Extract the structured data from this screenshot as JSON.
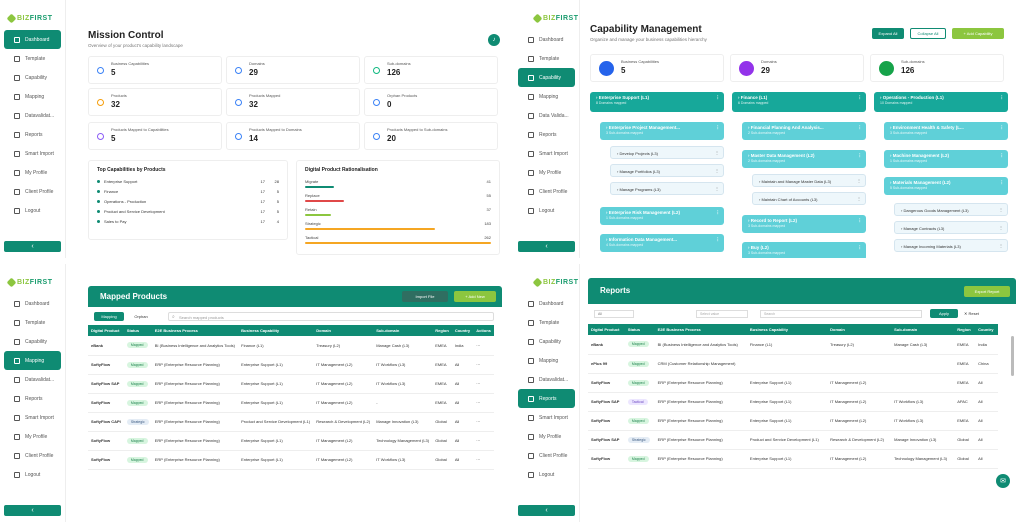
{
  "brand": {
    "name_a": "BIZ",
    "name_b": "FIRST"
  },
  "nav1": [
    "Dashboard",
    "Template",
    "Capability",
    "Mapping",
    "Datavalidat...",
    "Reports",
    "Smart Import",
    "My Profile",
    "Client Profile",
    "Logout"
  ],
  "nav2": [
    "Dashboard",
    "Template",
    "Capability",
    "Mapping",
    "Data Valida...",
    "Reports",
    "Smart Import",
    "My Profile",
    "Client Profile",
    "Logout"
  ],
  "nav3": [
    "Dashboard",
    "Template",
    "Capability",
    "Mapping",
    "Datavalidat...",
    "Reports",
    "Smart Import",
    "My Profile",
    "Client Profile",
    "Logout"
  ],
  "nav4": [
    "Dashboard",
    "Template",
    "Capability",
    "Mapping",
    "Datavalidat...",
    "Reports",
    "Smart Import",
    "My Profile",
    "Client Profile",
    "Logout"
  ],
  "collapse_glyph": "‹",
  "mission": {
    "title": "Mission Control",
    "subtitle": "Overview of your product's capability landscape",
    "stats": [
      {
        "label": "Business Capabilities",
        "value": "5"
      },
      {
        "label": "Domains",
        "value": "29"
      },
      {
        "label": "Sub-domains",
        "value": "126"
      },
      {
        "label": "Products",
        "value": "32"
      },
      {
        "label": "Products Mapped",
        "value": "32"
      },
      {
        "label": "Orphan Products",
        "value": "0"
      },
      {
        "label": "Products Mapped to Capabilities",
        "value": "5"
      },
      {
        "label": "Products Mapped to Domains",
        "value": "14"
      },
      {
        "label": "Products Mapped to Sub-domains",
        "value": "20"
      }
    ],
    "top_title": "Top Capabilities by Products",
    "top_items": [
      {
        "name": "Enterprise Support",
        "a": "17",
        "b": "28"
      },
      {
        "name": "Finance",
        "a": "17",
        "b": "5"
      },
      {
        "name": "Operations - Production",
        "a": "17",
        "b": "5"
      },
      {
        "name": "Product and Service Development",
        "a": "17",
        "b": "5"
      },
      {
        "name": "Sales to Pay",
        "a": "17",
        "b": "4"
      }
    ],
    "rat_title": "Digital Product Rationalisation",
    "rat_items": [
      {
        "name": "Migrate",
        "value": "41"
      },
      {
        "name": "Replace",
        "value": "55"
      },
      {
        "name": "Retain",
        "value": "37"
      },
      {
        "name": "Strategic",
        "value": "183"
      },
      {
        "name": "Tactical",
        "value": "262"
      }
    ]
  },
  "capability": {
    "title": "Capability Management",
    "subtitle": "Organize and manage your business capabilities hierarchy",
    "expand_all": "Expand All",
    "collapse_all": "Collapse All",
    "add": "+ Add Capability",
    "stats": [
      {
        "label": "Business Capabilities",
        "value": "5"
      },
      {
        "label": "Domains",
        "value": "29"
      },
      {
        "label": "Sub-domains",
        "value": "126"
      }
    ],
    "col1": {
      "title": "Enterprise Support (L1)",
      "sub": "8 Domains mapped",
      "domain": "Enterprise Project Management...",
      "domain_sub": "3 Sub-domains mapped",
      "leaves": [
        "Develop Projects (L3)",
        "Manage Portfolios (L3)",
        "Manage Programs (L3)"
      ],
      "d2": "Enterprise Risk Management (L2)",
      "d2_sub": "1 Sub-domains mapped",
      "d3": "Information Data Management...",
      "d3_sub": "4 Sub-domains mapped"
    },
    "col2": {
      "title": "Finance (L1)",
      "sub": "6 Domains mapped",
      "domain": "Financial Planning And Analysis...",
      "domain_sub": "2 Sub-domains mapped",
      "d2": "Master Data Management (L2)",
      "d2_sub": "2 Sub-domains mapped",
      "leaves": [
        "Maintain and Manage Master Data (L3)",
        "Maintain Chart of Accounts (L3)"
      ],
      "d3": "Record to Report (L2)",
      "d3_sub": "3 Sub-domains mapped",
      "d4": "Buy (L2)",
      "d4_sub": "3 Sub-domains mapped"
    },
    "col3": {
      "title": "Operations - Production (L1)",
      "sub": "10 Domains mapped",
      "domain": "Environment Health & Safety (L...",
      "domain_sub": "3 Sub-domains mapped",
      "d2": "Machine Management (L2)",
      "d2_sub": "1 Sub-domains mapped",
      "d3": "Materials Management (L2)",
      "d3_sub": "5 Sub-domains mapped",
      "leaves": [
        "Dangerous Goods Management (L3)",
        "Manage Contracts (L3)",
        "Manage Incoming Materials (L3)"
      ]
    }
  },
  "mapped": {
    "title": "Mapped Products",
    "import": "Import File",
    "add": "+ Add New",
    "tab_mapping": "Mapping",
    "tab_orphan": "Orphan",
    "search_placeholder": "Search mapped products",
    "headers": [
      "Digital Product",
      "Status",
      "E2E Business Process",
      "Business Capability",
      "Domain",
      "Sub-domain",
      "Region",
      "Country",
      "Actions"
    ],
    "rows": [
      [
        "eBank",
        "Mapped",
        "BI (Business Intelligence and Analytics Tools)",
        "Finance (L1)",
        "Treasury (L2)",
        "Manage Cash (L3)",
        "EMEA",
        "India",
        "⋯"
      ],
      [
        "SoftyFlow",
        "Mapped",
        "ERP (Enterprise Resource Planning)",
        "Enterprise Support (L1)",
        "IT Management (L2)",
        "IT Workflow (L3)",
        "EMEA",
        "All",
        "⋯"
      ],
      [
        "SoftyFlow SAP",
        "Mapped",
        "ERP (Enterprise Resource Planning)",
        "Enterprise Support (L1)",
        "IT Management (L2)",
        "IT Workflow (L3)",
        "EMEA",
        "All",
        "⋯"
      ],
      [
        "SoftyFlow",
        "Mapped",
        "ERP (Enterprise Resource Planning)",
        "Enterprise Support (L1)",
        "IT Management (L2)",
        "-",
        "EMEA",
        "All",
        "⋯"
      ],
      [
        "SoftyFlow CAPI",
        "Strategic",
        "ERP (Enterprise Resource Planning)",
        "Product and Service Development (L1)",
        "Research & Development (L2)",
        "Manage Innovation (L3)",
        "Global",
        "All",
        "⋯"
      ],
      [
        "SoftyFlow",
        "Mapped",
        "ERP (Enterprise Resource Planning)",
        "Enterprise Support (L1)",
        "IT Management (L2)",
        "Technology Management (L3)",
        "Global",
        "All",
        "⋯"
      ],
      [
        "SoftyFlow",
        "Mapped",
        "ERP (Enterprise Resource Planning)",
        "Enterprise Support (L1)",
        "IT Management (L2)",
        "IT Workflow (L3)",
        "Global",
        "All",
        "⋯"
      ]
    ]
  },
  "reports": {
    "title": "Reports",
    "export": "Export Report",
    "filter_all": "All",
    "filter2": "Select value",
    "filter3": "Search",
    "apply": "Apply",
    "reset": "Reset",
    "headers": [
      "Digital Product",
      "Status",
      "E2E Business Process",
      "Business Capability",
      "Domain",
      "Sub-domain",
      "Region",
      "Country"
    ],
    "rows": [
      [
        "eBank",
        "Mapped",
        "BI (Business Intelligence and Analytics Tools)",
        "Finance (L1)",
        "Treasury (L2)",
        "Manage Cash (L3)",
        "EMEA",
        "India"
      ],
      [
        "ePlus 99",
        "Mapped",
        "CRM (Customer Relationship Management)",
        "",
        "",
        "",
        "EMEA",
        "China"
      ],
      [
        "SoftyFlow",
        "Mapped",
        "ERP (Enterprise Resource Planning)",
        "Enterprise Support (L1)",
        "IT Management (L2)",
        "",
        "EMEA",
        "All"
      ],
      [
        "SoftyFlow SAP",
        "Tactical",
        "ERP (Enterprise Resource Planning)",
        "Enterprise Support (L1)",
        "IT Management (L2)",
        "IT Workflow (L3)",
        "APAC",
        "All"
      ],
      [
        "SoftyFlow",
        "Mapped",
        "ERP (Enterprise Resource Planning)",
        "Enterprise Support (L1)",
        "IT Management (L2)",
        "IT Workflow (L3)",
        "EMEA",
        "All"
      ],
      [
        "SoftyFlow SAP",
        "Strategic",
        "ERP (Enterprise Resource Planning)",
        "Product and Service Development (L1)",
        "Research & Development (L2)",
        "Manage Innovation (L3)",
        "Global",
        "All"
      ],
      [
        "SoftyFlow",
        "Mapped",
        "ERP (Enterprise Resource Planning)",
        "Enterprise Support (L1)",
        "IT Management (L2)",
        "Technology Management (L3)",
        "Global",
        "All"
      ]
    ]
  },
  "colors": {
    "primary": "#0f8b73",
    "accent": "#8cc63f",
    "node": "#17a89a",
    "node_light": "#5fd0d8"
  }
}
